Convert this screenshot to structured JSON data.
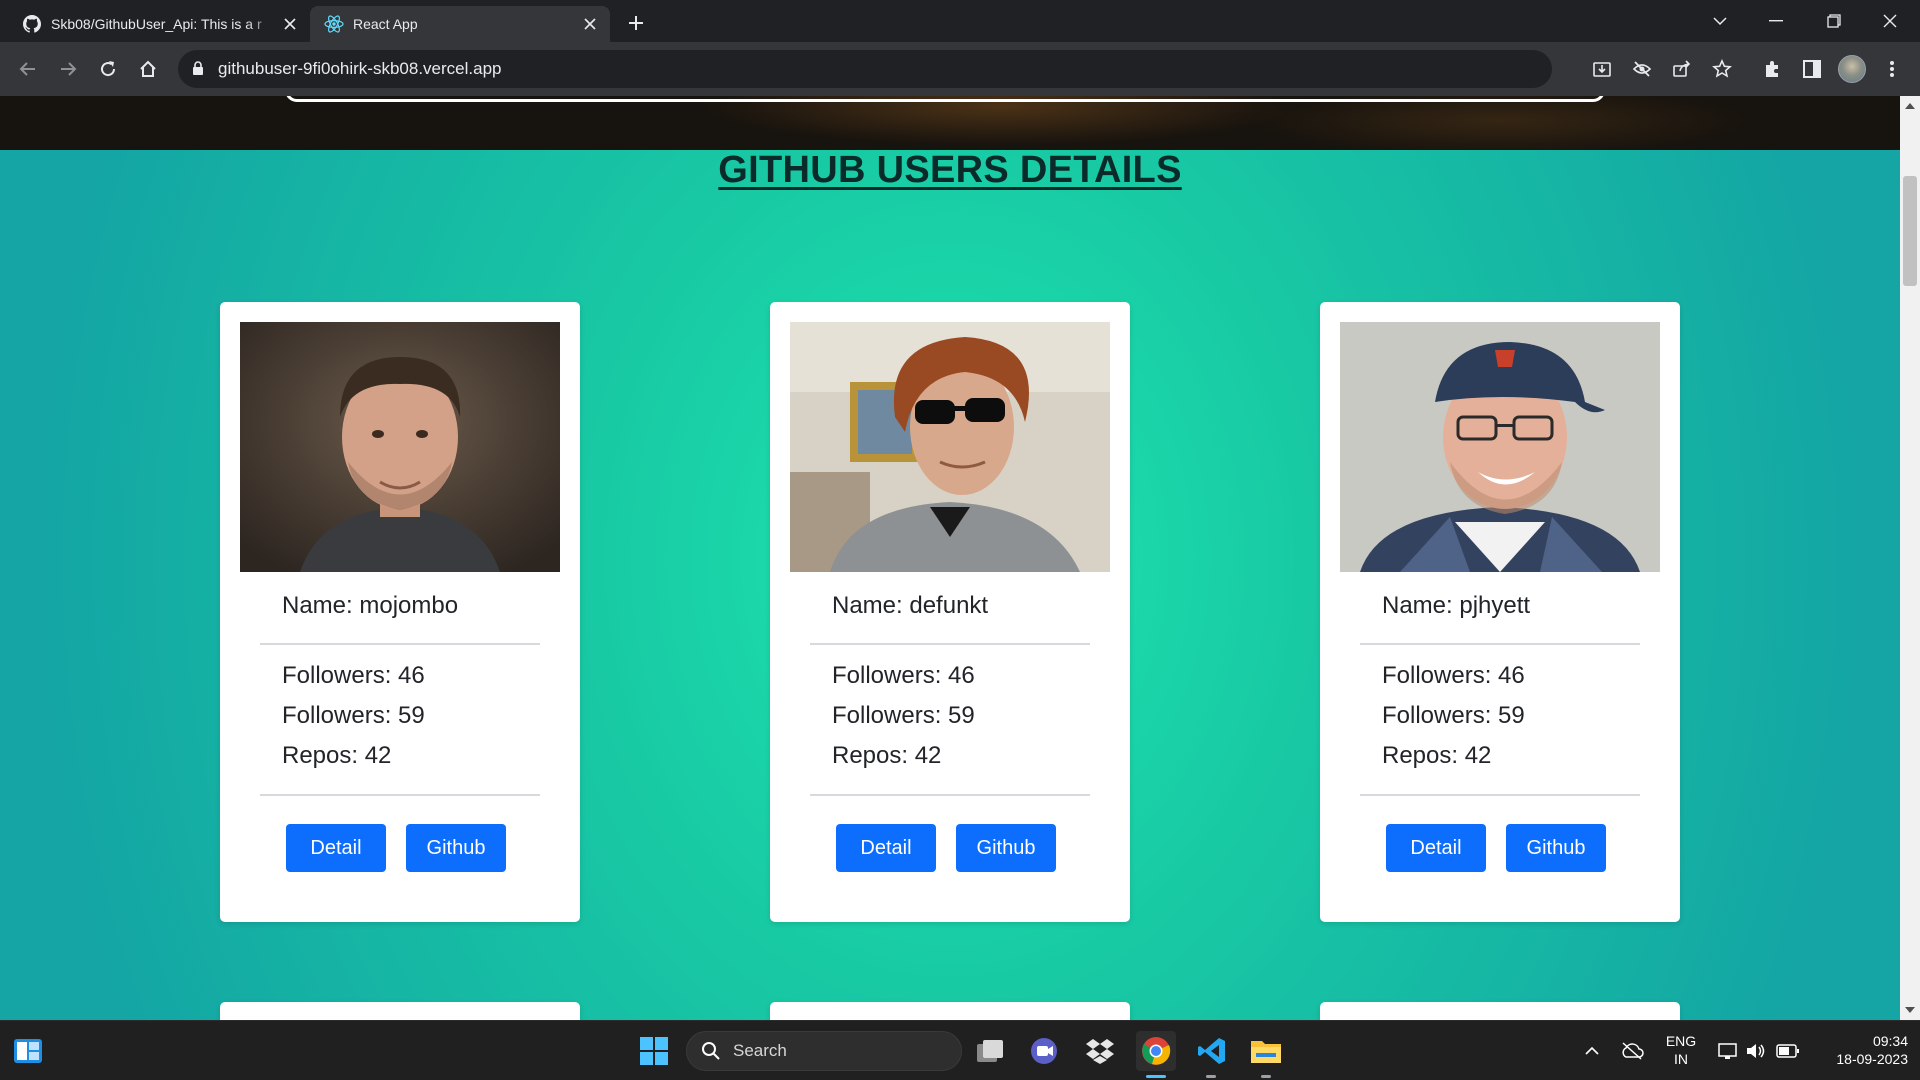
{
  "browser": {
    "tabs": [
      {
        "title": "Skb08/GithubUser_Api: This is a r",
        "favicon": "github-icon",
        "active": false
      },
      {
        "title": "React App",
        "favicon": "react-icon",
        "active": true
      }
    ],
    "url": "githubuser-9fi0ohirk-skb08.vercel.app"
  },
  "page": {
    "title": "GITHUB USERS DETAILS",
    "users": [
      {
        "name": "Name: mojombo",
        "followers": "Followers: 46",
        "following": "Followers: 59",
        "repos": "Repos: 42",
        "detail_label": "Detail",
        "github_label": "Github"
      },
      {
        "name": "Name: defunkt",
        "followers": "Followers: 46",
        "following": "Followers: 59",
        "repos": "Repos: 42",
        "detail_label": "Detail",
        "github_label": "Github"
      },
      {
        "name": "Name: pjhyett",
        "followers": "Followers: 46",
        "following": "Followers: 59",
        "repos": "Repos: 42",
        "detail_label": "Detail",
        "github_label": "Github"
      }
    ],
    "colors": {
      "background": "#1ee6ae",
      "button": "#0d6efd"
    }
  },
  "taskbar": {
    "search_label": "Search",
    "language_line1": "ENG",
    "language_line2": "IN",
    "time": "09:34",
    "date": "18-09-2023"
  }
}
